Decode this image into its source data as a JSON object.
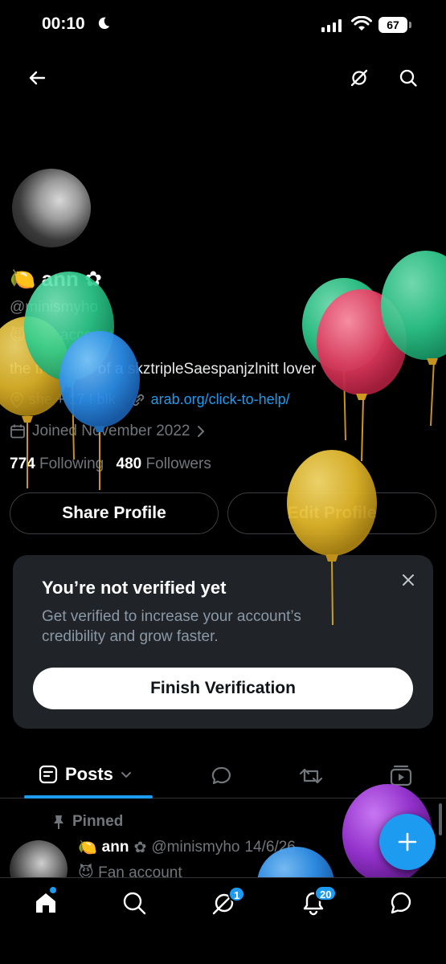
{
  "status_bar": {
    "time": "00:10",
    "battery": "67",
    "moon_icon": "crescent-moon-icon",
    "signal_icon": "cellular-signal-icon",
    "wifi_icon": "wifi-icon"
  },
  "header": {
    "back_icon": "arrow-left-icon",
    "grok_icon": "no-symbol-icon",
    "search_icon": "search-icon"
  },
  "profile": {
    "emoji_prefix": "🍋",
    "name": "ann",
    "name_suffix": "✿",
    "handle": "@minismyho",
    "fan_label": "😈 Fan account",
    "bio": "the thoughts of a skztripleSaespanjzlnitt lover",
    "location": "she + 17 ! blk",
    "website": "arab.org/click-to-help/",
    "joined": "Joined November 2022",
    "following_count": "774",
    "following_label": "Following",
    "followers_count": "480",
    "followers_label": "Followers"
  },
  "actions": {
    "share_label": "Share Profile",
    "edit_label": "Edit Profile"
  },
  "verify_card": {
    "title": "You’re not verified yet",
    "text": "Get verified to increase your account’s credibility and grow faster.",
    "button": "Finish Verification"
  },
  "tabs": {
    "posts_label": "Posts"
  },
  "pinned_post": {
    "pinned_label": "Pinned",
    "emoji_prefix": "🍋",
    "name": "ann",
    "name_suffix": "✿",
    "handle": "@minismyho",
    "date": "14/6/26",
    "fan_label": "😈 Fan account"
  },
  "bottom_nav": {
    "grok_badge": "1",
    "notifications_badge": "20"
  },
  "colors": {
    "accent": "#1d9bf0",
    "background": "#000000",
    "card": "#202327",
    "muted": "#71767b",
    "balloon_green": "#2fcf8f",
    "balloon_yellow": "#e0b62a",
    "balloon_blue": "#2c8ee8",
    "balloon_red": "#e0395e",
    "balloon_purple": "#9b35d6"
  }
}
